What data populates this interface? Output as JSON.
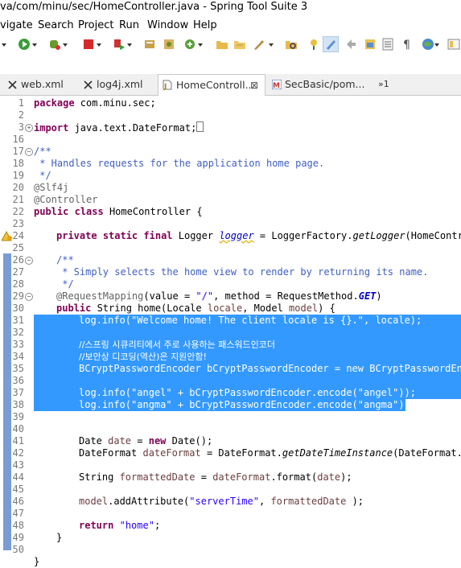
{
  "window": {
    "title": "va/com/minu/sec/HomeController.java - Spring Tool Suite 3"
  },
  "menu": [
    "vigate",
    "Search",
    "Project",
    "Run",
    "Window",
    "Help"
  ],
  "tabs": [
    {
      "label": "web.xml",
      "icon": "xml-file-icon"
    },
    {
      "label": "log4j.xml",
      "icon": "xml-file-icon"
    },
    {
      "label": "HomeControll...",
      "icon": "java-file-icon",
      "active": true
    },
    {
      "label": "SecBasic/pom...",
      "icon": "maven-pom-icon"
    }
  ],
  "overflow_count": "»1",
  "colors": {
    "selection": "#3399ff",
    "keyword": "#7f0055",
    "comment": "#3f5fbf",
    "string": "#2a00ff",
    "annotation": "#646464"
  },
  "code": {
    "l1": "1",
    "t1a": "package",
    "t1b": " com.minu.sec;",
    "l2": "2",
    "l3": "3",
    "t3a": "import",
    "t3b": " java.text.DateFormat;",
    "l16": "16",
    "l17": "17",
    "t17": "/**",
    "l18": "18",
    "t18": " * Handles requests for the application home page.",
    "l19": "19",
    "t19": " */",
    "l20": "20",
    "t20": "@Slf4j",
    "l21": "21",
    "t21": "@Controller",
    "l22": "22",
    "t22a": "public",
    "t22b": "class",
    "t22c": " HomeController {",
    "l23": "23",
    "l24": "24",
    "t24a": "private",
    "t24b": "static",
    "t24c": "final",
    "t24d": " Logger ",
    "t24e": "logger",
    "t24f": " = LoggerFactory.",
    "t24g": "getLogger",
    "t24h": "(HomeContro",
    "l25": "25",
    "l26": "26",
    "t26": "/**",
    "l27": "27",
    "t27": " * Simply selects the home view to render by returning its name.",
    "l28": "28",
    "t28": " */",
    "l29": "29",
    "t29a": "@RequestMapping",
    "t29b": "(value = ",
    "t29c": "\"/\"",
    "t29d": ", method = RequestMethod.",
    "t29e": "GET",
    "t29f": ")",
    "l30": "30",
    "t30a": "public",
    "t30b": " String home(Locale ",
    "t30c": "locale",
    "t30d": ", Model ",
    "t30e": "model",
    "t30f": ") {",
    "l31": "31",
    "t31": "log.info(\"Welcome home! The client locale is {}.\", locale);",
    "l32": "32",
    "l33": "33",
    "t33": "//스프링 시큐리티에서 주로 사용하는 패스워드인코더",
    "l34": "34",
    "t34": "//보안상 디코딩(역산)은 지원안함!",
    "l35": "35",
    "t35": "BCryptPasswordEncoder bCryptPasswordEncoder = new BCryptPasswordEnc",
    "l36": "36",
    "l37": "37",
    "t37": "log.info(\"angel\" + bCryptPasswordEncoder.encode(\"angel\"));",
    "l38": "38",
    "t38": "log.info(\"angma\" + bCryptPasswordEncoder.encode(\"angma\"));",
    "l39": "39",
    "l40": "40",
    "l41": "41",
    "t41a": "Date ",
    "t41b": "date",
    "t41c": " = ",
    "t41d": "new",
    "t41e": " Date();",
    "l42": "42",
    "t42a": "DateFormat ",
    "t42b": "dateFormat",
    "t42c": " = DateFormat.",
    "t42d": "getDateTimeInstance",
    "t42e": "(DateFormat.",
    "l43": "43",
    "l44": "44",
    "t44a": "String ",
    "t44b": "formattedDate",
    "t44c": " = ",
    "t44d": "dateFormat",
    "t44e": ".format(",
    "t44f": "date",
    "t44g": ");",
    "l45": "45",
    "l46": "46",
    "t46a": "model",
    "t46b": ".addAttribute(",
    "t46c": "\"serverTime\"",
    "t46d": ", ",
    "t46e": "formattedDate",
    "t46f": " );",
    "l47": "47",
    "l48": "48",
    "t48a": "return",
    "t48b": " ",
    "t48c": "\"home\"",
    "t48d": ";",
    "l49": "49",
    "t49": "}",
    "l50": "50",
    "l51": "",
    "t51": "}"
  }
}
